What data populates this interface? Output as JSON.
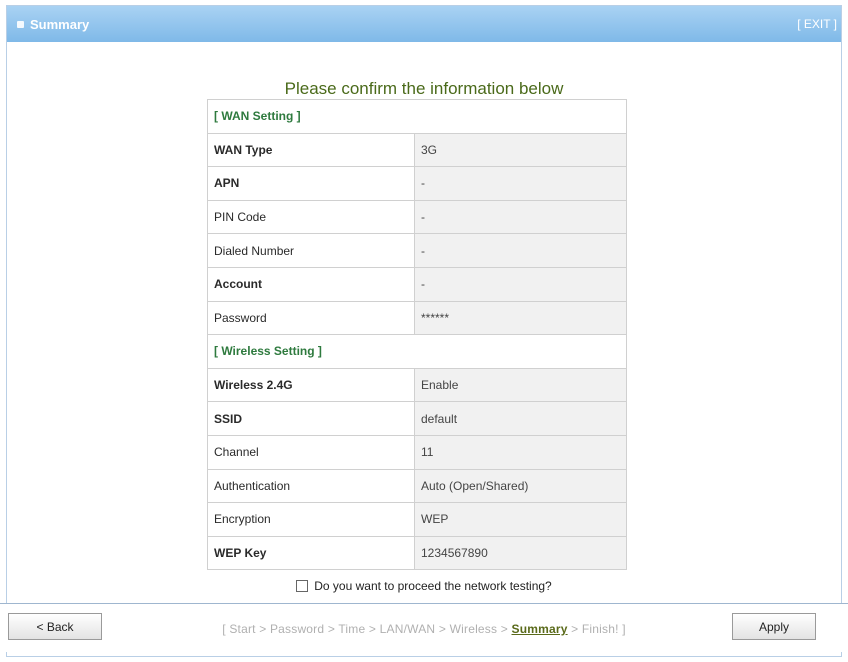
{
  "window": {
    "title": "Summary",
    "exit_label": "[ EXIT ]"
  },
  "heading": "Please confirm the information below",
  "wan": {
    "section_label": "[ WAN Setting ]",
    "rows": [
      {
        "label": "WAN Type",
        "value": "3G"
      },
      {
        "label": "APN",
        "value": "-"
      },
      {
        "label": "PIN Code",
        "value": "-"
      },
      {
        "label": "Dialed Number",
        "value": "-"
      },
      {
        "label": "Account",
        "value": "-"
      },
      {
        "label": "Password",
        "value": "******"
      }
    ]
  },
  "wireless": {
    "section_label": "[ Wireless Setting ]",
    "rows": [
      {
        "label": "Wireless 2.4G",
        "value": "Enable"
      },
      {
        "label": "SSID",
        "value": "default"
      },
      {
        "label": "Channel",
        "value": "11"
      },
      {
        "label": "Authentication",
        "value": "Auto (Open/Shared)"
      },
      {
        "label": "Encryption",
        "value": "WEP"
      },
      {
        "label": "WEP Key",
        "value": "1234567890"
      }
    ]
  },
  "testing": {
    "label": "Do you want to proceed the network testing?",
    "checked": false
  },
  "footer": {
    "back_label": "< Back",
    "apply_label": "Apply",
    "steps_open": "[",
    "steps_close": "]",
    "separator": ">",
    "steps": [
      "Start",
      "Password",
      "Time",
      "LAN/WAN",
      "Wireless",
      "Summary",
      "Finish!"
    ],
    "active_step": "Summary"
  }
}
